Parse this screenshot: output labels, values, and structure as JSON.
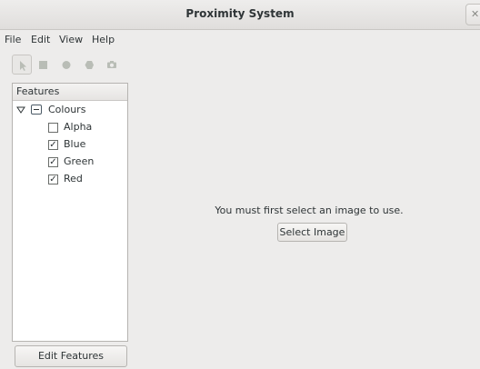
{
  "window": {
    "title": "Proximity System",
    "close_glyph": "✕"
  },
  "menubar": {
    "items": [
      "File",
      "Edit",
      "View",
      "Help"
    ]
  },
  "toolbar": {
    "tools": [
      {
        "icon": "pointer-icon",
        "active": true
      },
      {
        "icon": "square-icon",
        "active": false
      },
      {
        "icon": "circle-icon",
        "active": false
      },
      {
        "icon": "polygon-icon",
        "active": false
      },
      {
        "icon": "camera-icon",
        "active": false
      }
    ]
  },
  "features_panel": {
    "header": "Features",
    "tree": {
      "label": "Colours",
      "expanded": true,
      "children": [
        {
          "label": "Alpha",
          "checked": false
        },
        {
          "label": "Blue",
          "checked": true
        },
        {
          "label": "Green",
          "checked": true
        },
        {
          "label": "Red",
          "checked": true
        }
      ]
    },
    "edit_button": "Edit Features"
  },
  "main": {
    "message": "You must first select an image to use.",
    "select_button": "Select Image"
  },
  "colors": {
    "icon_gray": "#b9bdb6",
    "text": "#2e3436"
  }
}
